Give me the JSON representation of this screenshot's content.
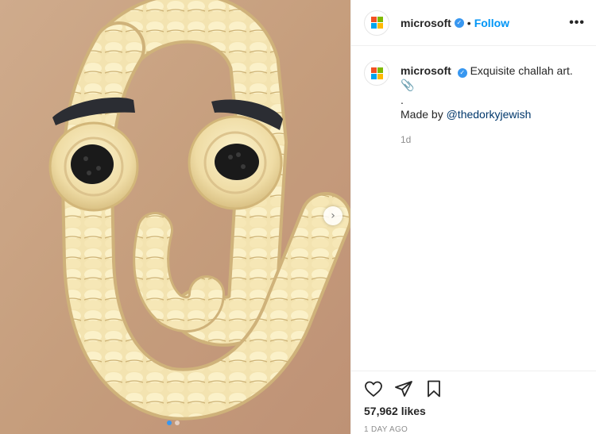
{
  "post": {
    "image_alt": "Challah bread braided into the shape of the Clippy paperclip with raisin eyes and dark eyebrows",
    "carousel": {
      "count": 2,
      "active": 0
    },
    "next_icon": "chevron-right-icon"
  },
  "header": {
    "username": "microsoft",
    "bullet": "•",
    "follow_label": "Follow",
    "more_label": "•••"
  },
  "caption": {
    "username": "microsoft",
    "text": "Exquisite challah art.",
    "emoji": "📎",
    "line2": ".",
    "made_by_prefix": "Made by ",
    "mention": "@thedorkyjewish",
    "time": "1d"
  },
  "actions": {
    "likes": "57,962 likes",
    "date": "1 DAY AGO"
  },
  "colors": {
    "ms_red": "#f25022",
    "ms_green": "#7fba00",
    "ms_blue": "#00a4ef",
    "ms_yellow": "#ffb900",
    "verified": "#3897f0",
    "follow": "#0095f6"
  }
}
